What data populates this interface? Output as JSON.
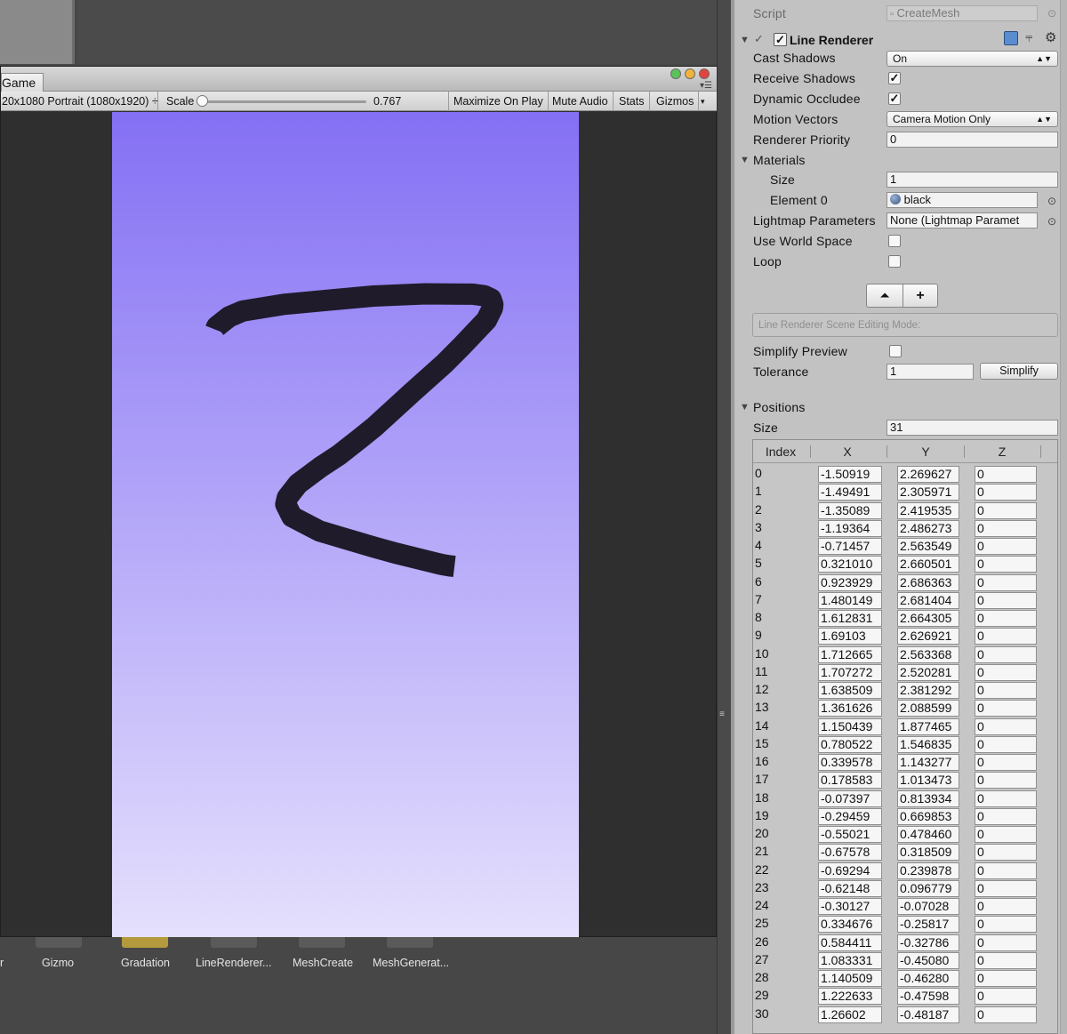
{
  "game_view": {
    "tab_label": "Game",
    "toolbar": {
      "resolution": "20x1080 Portrait (1080x1920) ÷",
      "scale_label": "Scale",
      "scale_value": "0.767",
      "maximize_on_play": "Maximize On Play",
      "mute_audio": "Mute Audio",
      "stats": "Stats",
      "gizmos": "Gizmos"
    },
    "gradient_colors": [
      "#8470f4",
      "#e5e0fd"
    ],
    "stroke_color": "#1f1b2b"
  },
  "project_assets": [
    {
      "label": "r"
    },
    {
      "label": "Gizmo"
    },
    {
      "label": "Gradation"
    },
    {
      "label": "LineRenderer..."
    },
    {
      "label": "MeshCreate"
    },
    {
      "label": "MeshGenerat..."
    }
  ],
  "inspector": {
    "script_label": "Script",
    "script_value": "CreateMesh",
    "component_title": "Line Renderer",
    "cast_shadows_label": "Cast Shadows",
    "cast_shadows_value": "On",
    "receive_shadows_label": "Receive Shadows",
    "receive_shadows_checked": true,
    "dynamic_occludee_label": "Dynamic Occludee",
    "dynamic_occludee_checked": true,
    "motion_vectors_label": "Motion Vectors",
    "motion_vectors_value": "Camera Motion Only",
    "renderer_priority_label": "Renderer Priority",
    "renderer_priority_value": "0",
    "materials_label": "Materials",
    "materials_size_label": "Size",
    "materials_size_value": "1",
    "element0_label": "Element 0",
    "element0_value": "black",
    "lightmap_label": "Lightmap Parameters",
    "lightmap_value": "None (Lightmap Paramet",
    "use_world_space_label": "Use World Space",
    "loop_label": "Loop",
    "scene_edit_mode_placeholder": "Line Renderer Scene Editing Mode:",
    "simplify_preview_label": "Simplify Preview",
    "tolerance_label": "Tolerance",
    "tolerance_value": "1",
    "simplify_button": "Simplify",
    "positions_label": "Positions",
    "positions_size_label": "Size",
    "positions_size_value": "31",
    "table_headers": {
      "index": "Index",
      "x": "X",
      "y": "Y",
      "z": "Z"
    },
    "positions": [
      {
        "i": "0",
        "x": "-1.50919",
        "y": "2.269627",
        "z": "0"
      },
      {
        "i": "1",
        "x": "-1.49491",
        "y": "2.305971",
        "z": "0"
      },
      {
        "i": "2",
        "x": "-1.35089",
        "y": "2.419535",
        "z": "0"
      },
      {
        "i": "3",
        "x": "-1.19364",
        "y": "2.486273",
        "z": "0"
      },
      {
        "i": "4",
        "x": "-0.71457",
        "y": "2.563549",
        "z": "0"
      },
      {
        "i": "5",
        "x": "0.321010",
        "y": "2.660501",
        "z": "0"
      },
      {
        "i": "6",
        "x": "0.923929",
        "y": "2.686363",
        "z": "0"
      },
      {
        "i": "7",
        "x": "1.480149",
        "y": "2.681404",
        "z": "0"
      },
      {
        "i": "8",
        "x": "1.612831",
        "y": "2.664305",
        "z": "0"
      },
      {
        "i": "9",
        "x": "1.69103",
        "y": "2.626921",
        "z": "0"
      },
      {
        "i": "10",
        "x": "1.712665",
        "y": "2.563368",
        "z": "0"
      },
      {
        "i": "11",
        "x": "1.707272",
        "y": "2.520281",
        "z": "0"
      },
      {
        "i": "12",
        "x": "1.638509",
        "y": "2.381292",
        "z": "0"
      },
      {
        "i": "13",
        "x": "1.361626",
        "y": "2.088599",
        "z": "0"
      },
      {
        "i": "14",
        "x": "1.150439",
        "y": "1.877465",
        "z": "0"
      },
      {
        "i": "15",
        "x": "0.780522",
        "y": "1.546835",
        "z": "0"
      },
      {
        "i": "16",
        "x": "0.339578",
        "y": "1.143277",
        "z": "0"
      },
      {
        "i": "17",
        "x": "0.178583",
        "y": "1.013473",
        "z": "0"
      },
      {
        "i": "18",
        "x": "-0.07397",
        "y": "0.813934",
        "z": "0"
      },
      {
        "i": "19",
        "x": "-0.29459",
        "y": "0.669853",
        "z": "0"
      },
      {
        "i": "20",
        "x": "-0.55021",
        "y": "0.478460",
        "z": "0"
      },
      {
        "i": "21",
        "x": "-0.67578",
        "y": "0.318509",
        "z": "0"
      },
      {
        "i": "22",
        "x": "-0.69294",
        "y": "0.239878",
        "z": "0"
      },
      {
        "i": "23",
        "x": "-0.62148",
        "y": "0.096779",
        "z": "0"
      },
      {
        "i": "24",
        "x": "-0.30127",
        "y": "-0.07028",
        "z": "0"
      },
      {
        "i": "25",
        "x": "0.334676",
        "y": "-0.25817",
        "z": "0"
      },
      {
        "i": "26",
        "x": "0.584411",
        "y": "-0.32786",
        "z": "0"
      },
      {
        "i": "27",
        "x": "1.083331",
        "y": "-0.45080",
        "z": "0"
      },
      {
        "i": "28",
        "x": "1.140509",
        "y": "-0.46280",
        "z": "0"
      },
      {
        "i": "29",
        "x": "1.222633",
        "y": "-0.47598",
        "z": "0"
      },
      {
        "i": "30",
        "x": "1.26602",
        "y": "-0.48187",
        "z": "0"
      }
    ]
  }
}
